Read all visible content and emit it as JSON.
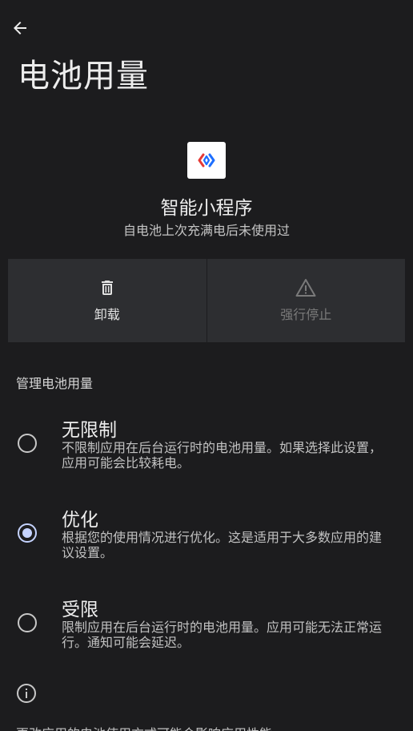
{
  "header": {
    "title": "电池用量"
  },
  "app": {
    "name": "智能小程序",
    "subtitle": "自电池上次充满电后未使用过"
  },
  "actions": {
    "uninstall_label": "卸载",
    "force_stop_label": "强行停止"
  },
  "section": {
    "title": "管理电池用量"
  },
  "options": [
    {
      "title": "无限制",
      "description": "不限制应用在后台运行时的电池用量。如果选择此设置，应用可能会比较耗电。",
      "selected": false
    },
    {
      "title": "优化",
      "description": "根据您的使用情况进行优化。这是适用于大多数应用的建议设置。",
      "selected": true
    },
    {
      "title": "受限",
      "description": "限制应用在后台运行时的电池用量。应用可能无法正常运行。通知可能会延迟。",
      "selected": false
    }
  ],
  "footer": {
    "text": "更改应用的电池使用方式可能会影响应用性能。"
  },
  "colors": {
    "background": "#1c1c1e",
    "accent": "#c5d3ff",
    "card": "#2d2e31"
  }
}
